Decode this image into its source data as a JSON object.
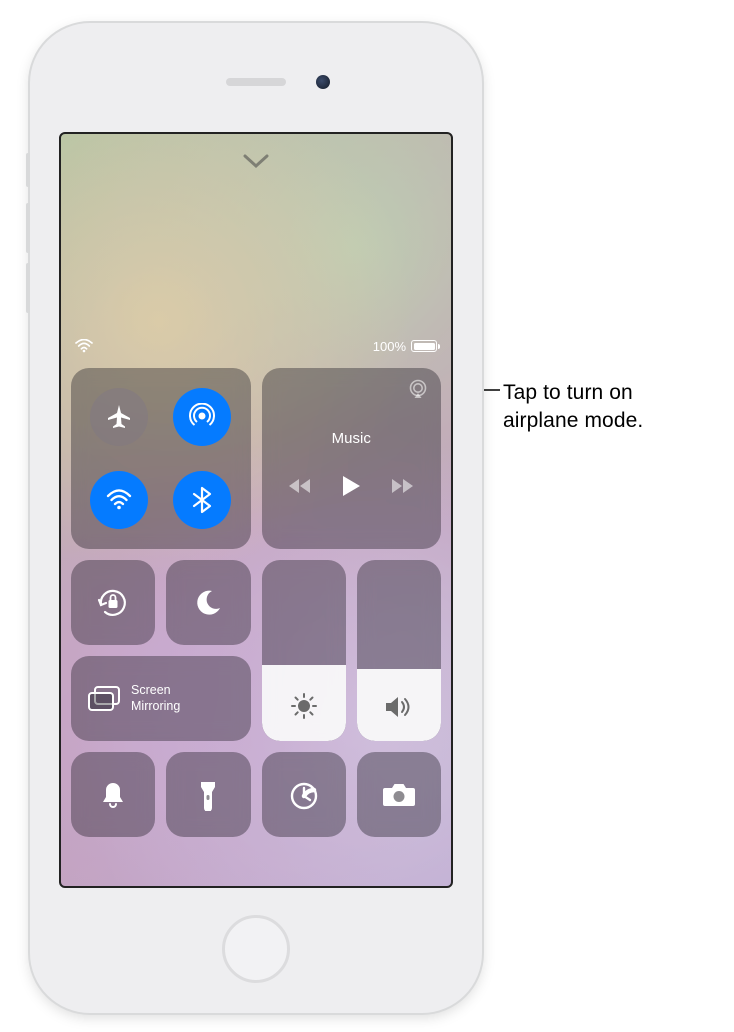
{
  "domain": "Computer-Use",
  "device": "iPod touch",
  "status_bar": {
    "wifi_icon": "wifi-icon",
    "battery_percent": "100%",
    "battery_level_pct": 100
  },
  "dismiss_chevron": "⌄",
  "connectivity": {
    "airplane": {
      "icon": "airplane-icon",
      "state": "off"
    },
    "airdrop": {
      "icon": "airdrop-icon",
      "state": "on"
    },
    "wifi": {
      "icon": "wifi-icon",
      "state": "on"
    },
    "bluetooth": {
      "icon": "bluetooth-icon",
      "state": "on"
    }
  },
  "media": {
    "title": "Music",
    "airplay_icon": "airplay-audio-icon",
    "prev_icon": "skip-back-icon",
    "play_icon": "play-icon",
    "next_icon": "skip-forward-icon"
  },
  "controls": {
    "orientation_lock": {
      "icon": "orientation-lock-icon"
    },
    "do_not_disturb": {
      "icon": "moon-icon"
    },
    "screen_mirroring": {
      "icon": "screen-mirroring-icon",
      "label": "Screen\nMirroring"
    },
    "brightness": {
      "icon": "sun-icon",
      "level_pct": 42
    },
    "volume": {
      "icon": "speaker-icon",
      "level_pct": 40
    },
    "ringer": {
      "icon": "bell-icon"
    },
    "flashlight": {
      "icon": "flashlight-icon"
    },
    "timer": {
      "icon": "timer-icon"
    },
    "camera": {
      "icon": "camera-icon"
    }
  },
  "callout": {
    "text": "Tap to turn on airplane mode."
  }
}
